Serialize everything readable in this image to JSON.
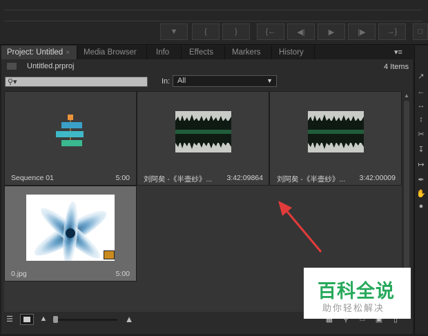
{
  "transport": {
    "buttons": [
      "marker-icon",
      "in-point-icon",
      "out-point-icon",
      "go-to-in-icon",
      "step-back-icon",
      "play-icon",
      "step-forward-icon",
      "go-to-out-icon",
      "insert-icon"
    ]
  },
  "tabs": [
    {
      "label": "Project: Untitled",
      "close": "×"
    },
    {
      "label": "Media Browser"
    },
    {
      "label": "Info"
    },
    {
      "label": "Effects"
    },
    {
      "label": "Markers"
    },
    {
      "label": "History"
    }
  ],
  "panel_menu": "▾≡",
  "project": {
    "file_name": "Untitled.prproj",
    "item_count": "4 Items",
    "search_placeholder": "",
    "in_label": "In:",
    "in_value": "All"
  },
  "items": [
    {
      "name": "Sequence 01",
      "duration": "5:00",
      "type": "sequence"
    },
    {
      "name": "刘阿矣 -《半壶纱》...",
      "duration": "3:42:09864",
      "type": "audio"
    },
    {
      "name": "刘阿矣 -《半壶纱》...",
      "duration": "3:42:00009",
      "type": "audio"
    },
    {
      "name": "0.jpg",
      "duration": "5:00",
      "type": "image"
    }
  ],
  "watermark": {
    "title": "百科全说",
    "subtitle": "助你轻松解决"
  },
  "colors": {
    "accent_arrow": "#e23b3b",
    "watermark_green": "#27a95c"
  }
}
